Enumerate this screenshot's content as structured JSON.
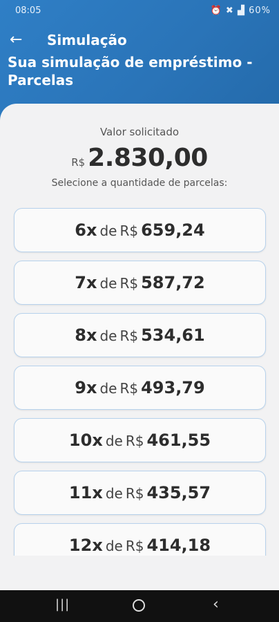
{
  "status_bar": {
    "time": "08:05",
    "icons_text": "⏰ ✖ 📶 60%",
    "battery": "60%"
  },
  "header": {
    "back_icon": "arrow-left-icon",
    "title": "Simulação",
    "heading": "Sua simulação de empréstimo - Parcelas"
  },
  "summary": {
    "label": "Valor solicitado",
    "currency": "R$",
    "amount": "2.830,00",
    "instruction": "Selecione a quantidade de parcelas:"
  },
  "installments": [
    {
      "count": "6x",
      "de": "de",
      "currency": "R$",
      "amount": "659,24"
    },
    {
      "count": "7x",
      "de": "de",
      "currency": "R$",
      "amount": "587,72"
    },
    {
      "count": "8x",
      "de": "de",
      "currency": "R$",
      "amount": "534,61"
    },
    {
      "count": "9x",
      "de": "de",
      "currency": "R$",
      "amount": "493,79"
    },
    {
      "count": "10x",
      "de": "de",
      "currency": "R$",
      "amount": "461,55"
    },
    {
      "count": "11x",
      "de": "de",
      "currency": "R$",
      "amount": "435,57"
    },
    {
      "count": "12x",
      "de": "de",
      "currency": "R$",
      "amount": "414,18"
    }
  ],
  "nav": {
    "recent": "recent-apps-icon",
    "home": "home-icon",
    "back": "back-icon"
  }
}
